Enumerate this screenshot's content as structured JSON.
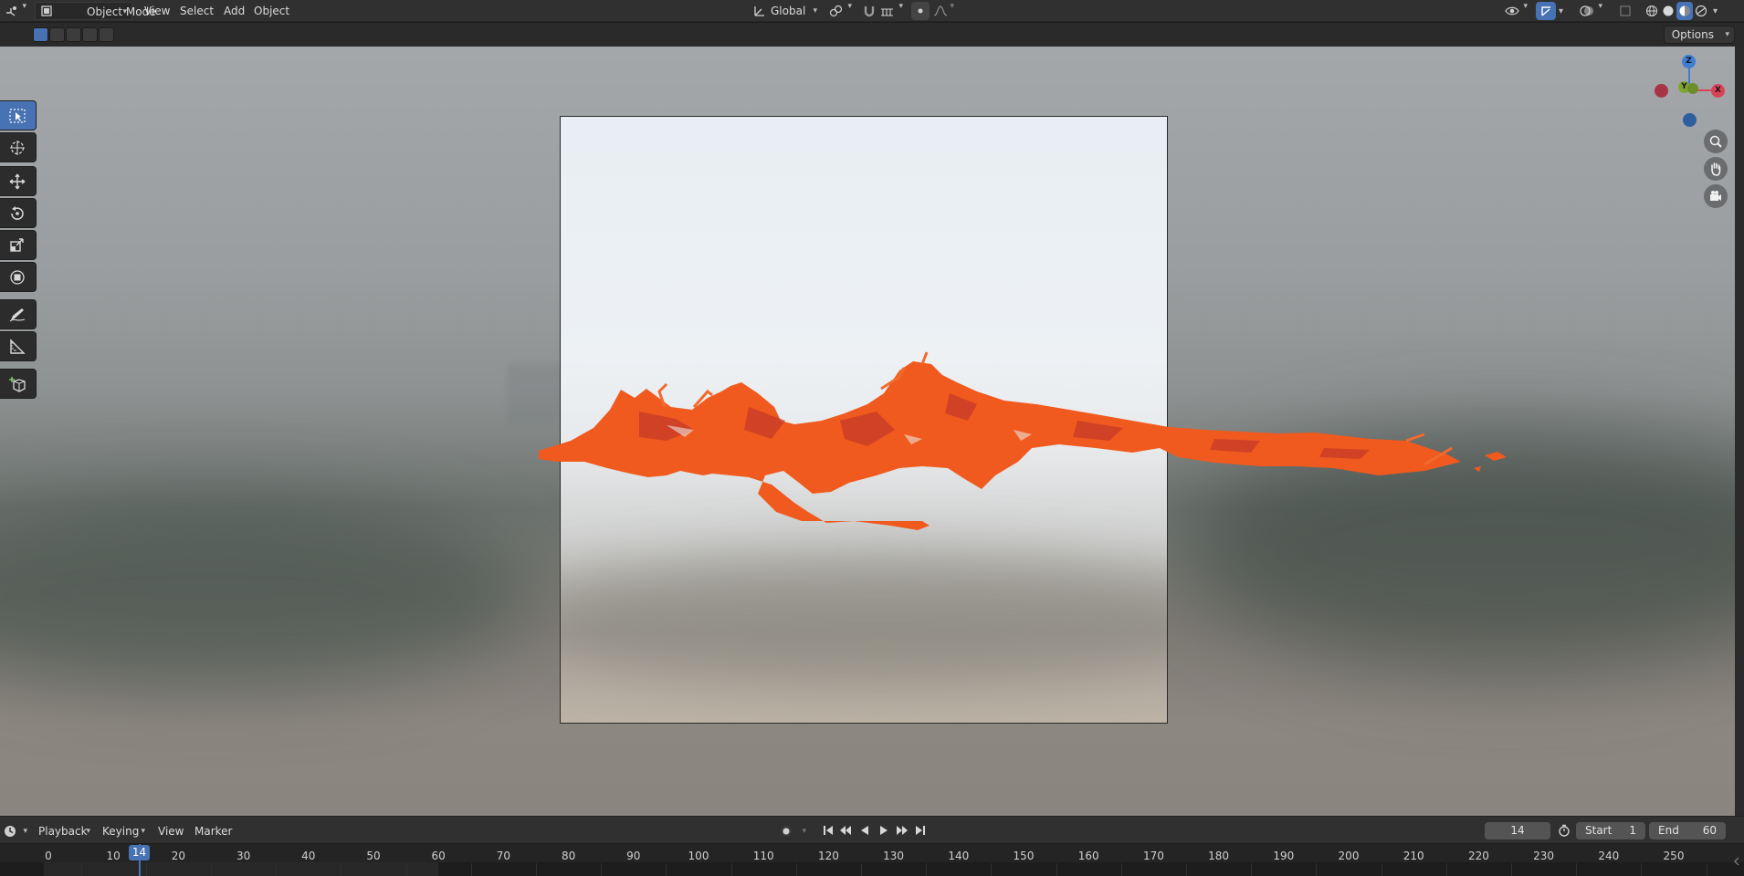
{
  "header": {
    "editor_type_icon": "view3d-editor-icon",
    "mode_label": "Object Mode",
    "menus": [
      "View",
      "Select",
      "Add",
      "Object"
    ],
    "transform_orientation": "Global"
  },
  "tool_settings": {
    "options_label": "Options"
  },
  "viewport": {
    "gizmo": {
      "z_label": "Z",
      "x_label": "X",
      "y_label": "Y"
    },
    "colors": {
      "fluid": "#f05a1e",
      "axis_x": "#d94358",
      "axis_y": "#7fa531",
      "axis_z": "#3e7ed3",
      "active_blue": "#4772b3"
    }
  },
  "timeline": {
    "menus": [
      "Playback",
      "Keying",
      "View",
      "Marker"
    ],
    "current_frame": "14",
    "start_label": "Start",
    "start_value": "1",
    "end_label": "End",
    "end_value": "60",
    "ruler_ticks": [
      "0",
      "10",
      "20",
      "30",
      "40",
      "50",
      "60",
      "70",
      "80",
      "90",
      "100",
      "110",
      "120",
      "130",
      "140",
      "150",
      "160",
      "170",
      "180",
      "190",
      "200",
      "210",
      "220",
      "230",
      "240",
      "250"
    ],
    "playhead_label": "14"
  }
}
